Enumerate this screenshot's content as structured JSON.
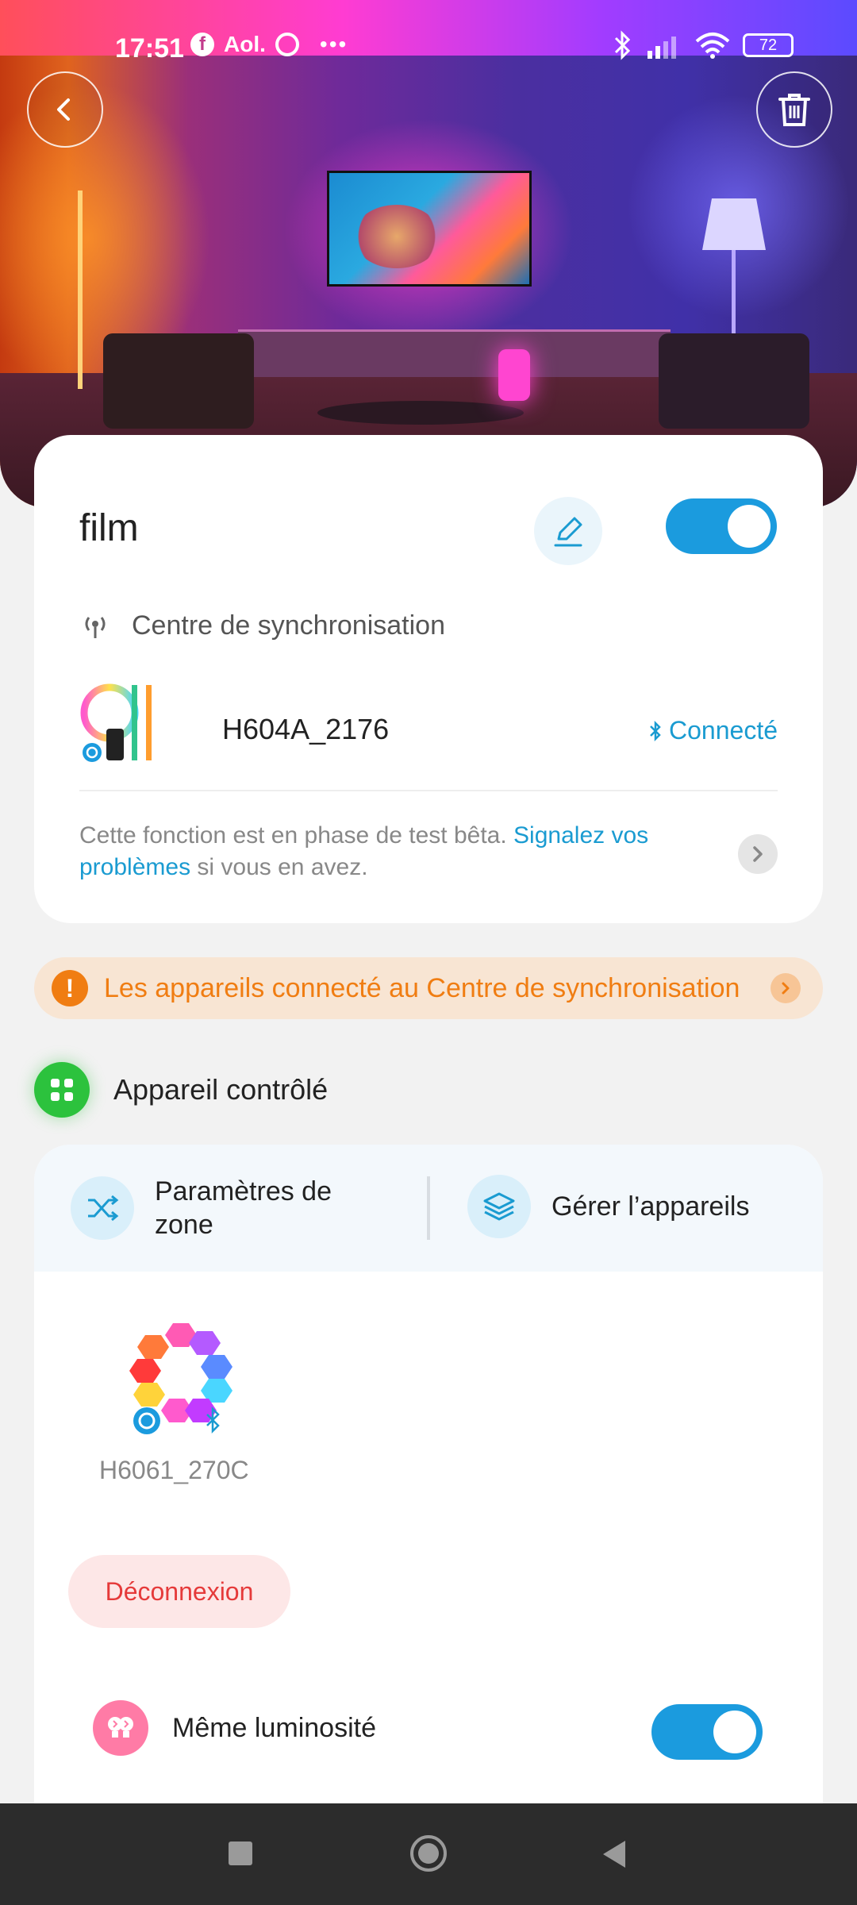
{
  "status_bar": {
    "time": "17:51",
    "app_label": "Aol.",
    "battery": "72",
    "icons": [
      "facebook-icon",
      "aol-icon",
      "circle-icon",
      "more-icon",
      "bluetooth-icon",
      "signal-icon",
      "wifi-icon",
      "battery-icon"
    ]
  },
  "scene": {
    "title": "film",
    "enabled": true,
    "sync_center_label": "Centre de synchronisation",
    "hub_device": {
      "name": "H604A_2176",
      "status": "Connecté"
    },
    "beta_notice": {
      "text_before": "Cette fonction est en phase de test bêta.",
      "link": "Signalez vos problèmes",
      "text_after": "si vous en avez."
    }
  },
  "warning": {
    "text": "Les appareils connecté au Centre de synchronisation"
  },
  "controlled": {
    "section_title": "Appareil contrôlé",
    "tabs": [
      {
        "label": "Paramètres de zone"
      },
      {
        "label": "Gérer l’appareils"
      }
    ],
    "device": {
      "name": "H6061_270C"
    },
    "disconnect_label": "Déconnexion",
    "same_brightness": {
      "label": "Même luminosité",
      "enabled": true
    }
  },
  "colors": {
    "accent": "#1b9bde",
    "link": "#1a9bd1",
    "warning": "#f07d12",
    "danger": "#e53a3a",
    "section_green": "#2cc23d"
  }
}
